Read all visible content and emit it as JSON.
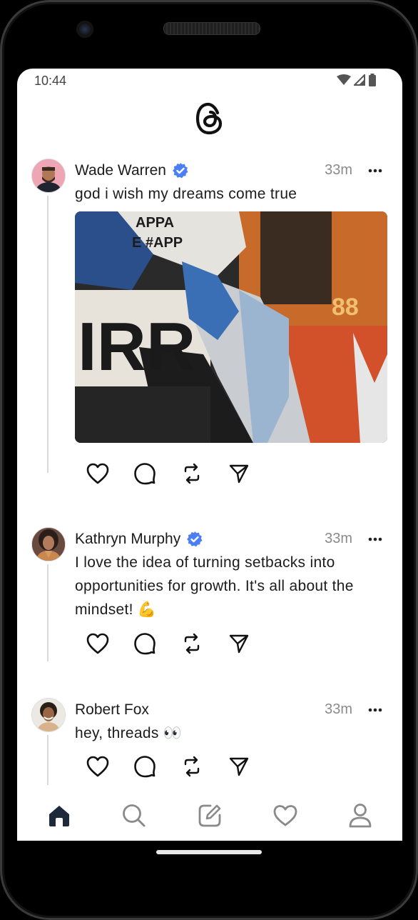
{
  "status_bar": {
    "time": "10:44",
    "icons": [
      "wifi-icon",
      "cellular-signal-icon",
      "battery-icon"
    ]
  },
  "app": {
    "logo": "threads-logo"
  },
  "posts": [
    {
      "username": "Wade Warren",
      "verified": true,
      "timestamp": "33m",
      "text": "god i wish my dreams come true",
      "has_image": true,
      "image_visible_text": [
        "APPA",
        "E #APP",
        "IRR",
        "88"
      ]
    },
    {
      "username": "Kathryn Murphy",
      "verified": true,
      "timestamp": "33m",
      "text": "I love the idea of turning setbacks into opportunities for growth. It's all about the mindset! 💪",
      "has_image": false
    },
    {
      "username": "Robert Fox",
      "verified": false,
      "timestamp": "33m",
      "text": "hey, threads 👀",
      "has_image": false
    }
  ],
  "post_actions": [
    "like-icon",
    "comment-icon",
    "repost-icon",
    "share-icon"
  ],
  "bottom_nav": [
    {
      "name": "home",
      "icon": "home-icon",
      "active": true
    },
    {
      "name": "search",
      "icon": "search-icon",
      "active": false
    },
    {
      "name": "compose",
      "icon": "compose-icon",
      "active": false
    },
    {
      "name": "activity",
      "icon": "heart-icon",
      "active": false
    },
    {
      "name": "profile",
      "icon": "profile-icon",
      "active": false
    }
  ],
  "colors": {
    "verified_badge": "#4a7ff5",
    "text_primary": "#1c1c1c",
    "text_secondary": "#8a8a8a",
    "nav_active": "#1e2a3a",
    "nav_inactive": "#8a8a8a"
  }
}
